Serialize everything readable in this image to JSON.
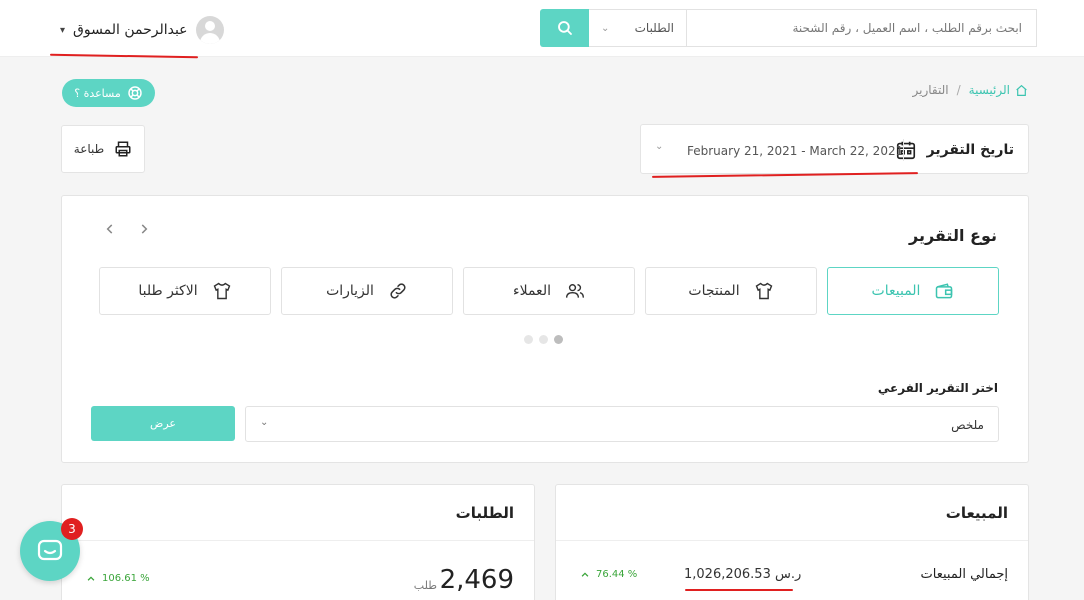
{
  "header": {
    "user_name": "عبدالرحمن المسوق",
    "search": {
      "placeholder": "ابحث برقم الطلب ، اسم العميل ، رقم الشحنة",
      "scope": "الطلبات"
    }
  },
  "breadcrumb": {
    "home": "الرئيسية",
    "separator": "/",
    "current": "التقارير"
  },
  "help_button": "مساعدة ؟",
  "print_button": "طباعة",
  "date_filter": {
    "label": "تاريخ التقرير",
    "range": "February 21, 2021 - March 22, 2021"
  },
  "report_type": {
    "title": "نوع التقرير",
    "tiles": [
      {
        "label": "المبيعات",
        "icon": "wallet-icon",
        "active": true
      },
      {
        "label": "المنتجات",
        "icon": "shirt-icon",
        "active": false
      },
      {
        "label": "العملاء",
        "icon": "users-icon",
        "active": false
      },
      {
        "label": "الزيارات",
        "icon": "link-icon",
        "active": false
      },
      {
        "label": "الاكثر طلبا",
        "icon": "shirt-icon",
        "active": false
      }
    ],
    "pagination": {
      "pages": 3,
      "active": 1
    },
    "sub_report": {
      "label": "اختر التقرير الفرعي",
      "value": "ملخص"
    },
    "show_button": "عرض"
  },
  "orders_card": {
    "title": "الطلبات",
    "value": "2,469",
    "unit": "طلب",
    "change": "106.61 %"
  },
  "sales_card": {
    "title": "المبيعات",
    "label": "إجمالي المبيعات",
    "value": "1,026,206.53 ر.س",
    "change": "76.44 %"
  },
  "chat": {
    "badge": "3"
  },
  "colors": {
    "accent": "#5dd5c4",
    "positive": "#3aa53a",
    "badge": "#e02020"
  }
}
